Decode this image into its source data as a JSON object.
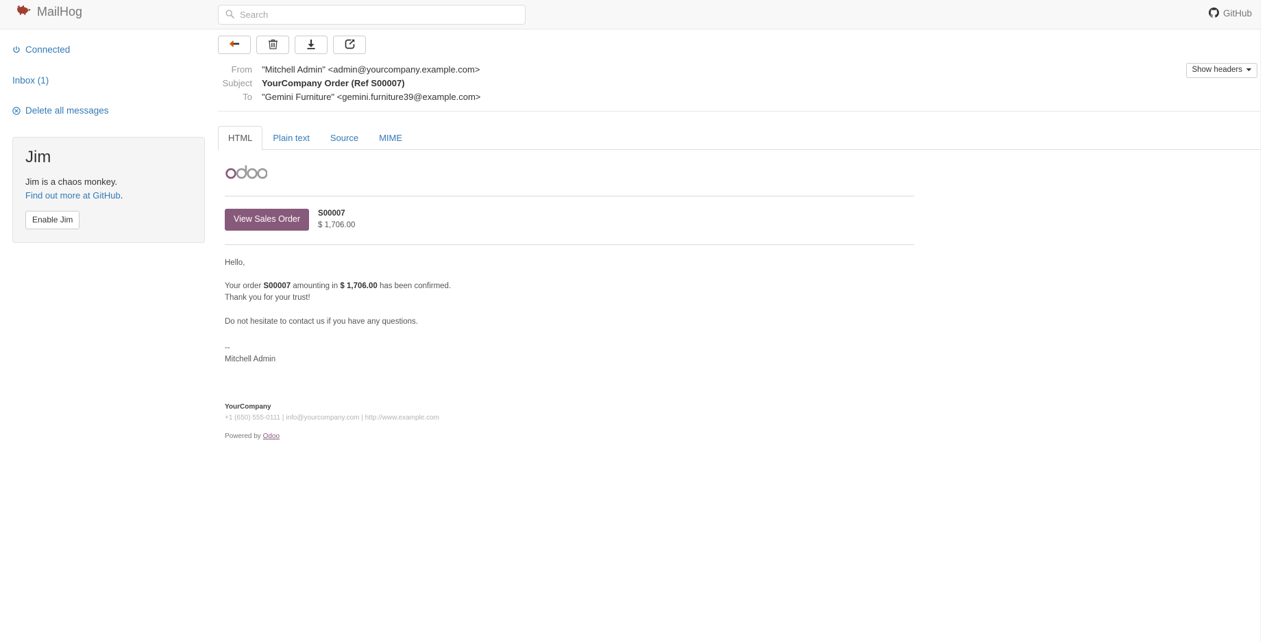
{
  "navbar": {
    "brand": "MailHog",
    "brand_icon": "pig-icon",
    "search": {
      "placeholder": "Search",
      "value": "",
      "icon": "search-icon"
    },
    "github": {
      "label": "GitHub",
      "icon": "github-icon"
    }
  },
  "sidebar": {
    "links": [
      {
        "label": "Connected",
        "icon": "power-icon"
      },
      {
        "label": "Inbox (1)",
        "icon": "none"
      },
      {
        "label": "Delete all messages",
        "icon": "circle-x-icon"
      }
    ],
    "jim": {
      "title": "Jim",
      "description": "Jim is a chaos monkey.",
      "link_text": "Find out more at GitHub",
      "link_suffix": ".",
      "button": "Enable Jim"
    }
  },
  "toolbar": {
    "buttons": [
      {
        "name": "back-button",
        "icon": "arrow-left-icon",
        "title": "Back"
      },
      {
        "name": "delete-button",
        "icon": "trash-icon",
        "title": "Delete"
      },
      {
        "name": "download-button",
        "icon": "download-icon",
        "title": "Download"
      },
      {
        "name": "release-button",
        "icon": "release-icon",
        "title": "Release"
      }
    ]
  },
  "message": {
    "headers": [
      {
        "label": "From",
        "value": "\"Mitchell Admin\" <admin@yourcompany.example.com>",
        "bold": false
      },
      {
        "label": "Subject",
        "value": "YourCompany Order (Ref S00007)",
        "bold": true
      },
      {
        "label": "To",
        "value": "\"Gemini Furniture\" <gemini.furniture39@example.com>",
        "bold": false
      }
    ],
    "show_headers_label": "Show headers",
    "tabs": [
      {
        "label": "HTML",
        "active": true
      },
      {
        "label": "Plain text",
        "active": false
      },
      {
        "label": "Source",
        "active": false
      },
      {
        "label": "MIME",
        "active": false
      }
    ]
  },
  "email": {
    "logo_alt": "odoo",
    "cta_button": "View Sales Order",
    "order_ref": "S00007",
    "order_amount": "$ 1,706.00",
    "greeting": "Hello,",
    "line_order_prefix": "Your order ",
    "line_order_ref": "S00007",
    "line_order_mid": " amounting in ",
    "line_order_amount": "$ 1,706.00",
    "line_order_suffix": " has been confirmed.",
    "line_thanks": "Thank you for your trust!",
    "line_contact": "Do not hesitate to contact us if you have any questions.",
    "sig_dashes": "--",
    "sig_name": "Mitchell Admin",
    "footer_company": "YourCompany",
    "footer_contact": "+1 (650) 555-0111 | info@yourcompany.com | http://www.example.com",
    "footer_powered_prefix": "Powered by ",
    "footer_powered_link": "Odoo"
  },
  "colors": {
    "brand_pig": "#a03f32",
    "link": "#337ab7",
    "odoo_purple": "#875A7B",
    "navbar_bg": "#f8f8f8",
    "panel_bg": "#f5f5f5"
  }
}
